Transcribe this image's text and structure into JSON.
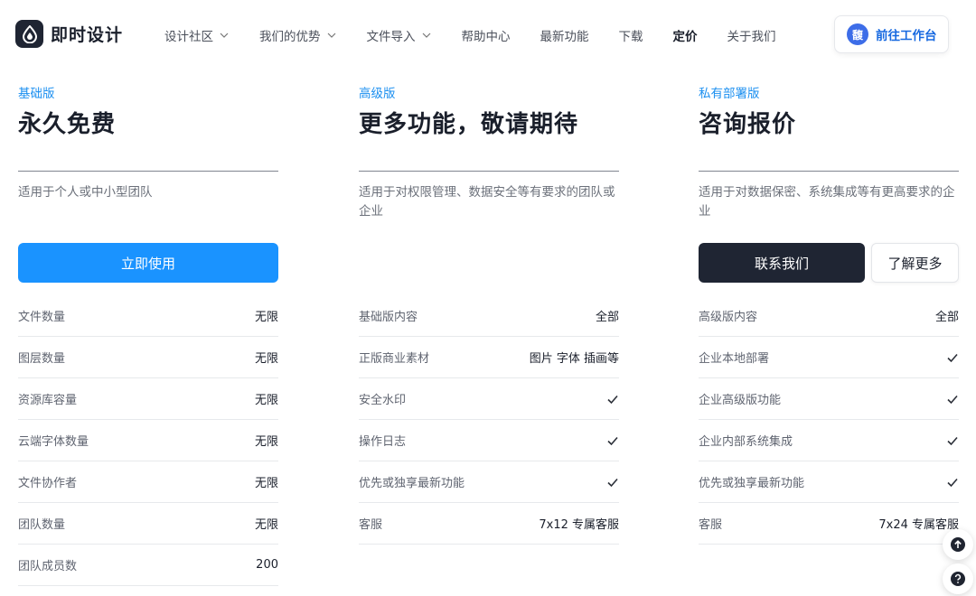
{
  "brand": {
    "name": "即时设计",
    "logo_icon": "droplet-icon"
  },
  "nav": [
    {
      "label": "设计社区",
      "dropdown": true
    },
    {
      "label": "我们的优势",
      "dropdown": true
    },
    {
      "label": "文件导入",
      "dropdown": true
    },
    {
      "label": "帮助中心",
      "dropdown": false
    },
    {
      "label": "最新功能",
      "dropdown": false
    },
    {
      "label": "下载",
      "dropdown": false
    },
    {
      "label": "定价",
      "dropdown": false,
      "active": true
    },
    {
      "label": "关于我们",
      "dropdown": false
    }
  ],
  "workspace": {
    "avatar_text": "馥",
    "label": "前往工作台"
  },
  "plans": [
    {
      "tier": "基础版",
      "price": "永久免费",
      "description": "适用于个人或中小型团队",
      "primary_button": "立即使用",
      "features": [
        {
          "name": "文件数量",
          "value": "无限"
        },
        {
          "name": "图层数量",
          "value": "无限"
        },
        {
          "name": "资源库容量",
          "value": "无限"
        },
        {
          "name": "云端字体数量",
          "value": "无限"
        },
        {
          "name": "文件协作者",
          "value": "无限"
        },
        {
          "name": "团队数量",
          "value": "无限"
        },
        {
          "name": "团队成员数",
          "value": "200"
        }
      ]
    },
    {
      "tier": "高级版",
      "price": "更多功能，敬请期待",
      "description": "适用于对权限管理、数据安全等有要求的团队或企业",
      "features": [
        {
          "name": "基础版内容",
          "value": "全部"
        },
        {
          "name": "正版商业素材",
          "value": "图片 字体 插画等"
        },
        {
          "name": "安全水印",
          "value": "",
          "check": true
        },
        {
          "name": "操作日志",
          "value": "",
          "check": true
        },
        {
          "name": "优先或独享最新功能",
          "value": "",
          "check": true
        },
        {
          "name": "客服",
          "value": "7x12 专属客服"
        }
      ]
    },
    {
      "tier": "私有部署版",
      "price": "咨询报价",
      "description": "适用于对数据保密、系统集成等有更高要求的企业",
      "contact_button": "联系我们",
      "more_button": "了解更多",
      "features": [
        {
          "name": "高级版内容",
          "value": "全部"
        },
        {
          "name": "企业本地部署",
          "value": "",
          "check": true
        },
        {
          "name": "企业高级版功能",
          "value": "",
          "check": true
        },
        {
          "name": "企业内部系统集成",
          "value": "",
          "check": true
        },
        {
          "name": "优先或独享最新功能",
          "value": "",
          "check": true
        },
        {
          "name": "客服",
          "value": "7x24 专属客服"
        }
      ]
    }
  ],
  "float": {
    "top_icon": "arrow-up-icon",
    "help_icon": "question-icon"
  },
  "colors": {
    "accent": "#1a93ff",
    "dark": "#1f2533",
    "tier": "#1b8ff0",
    "link": "#1769e0"
  }
}
